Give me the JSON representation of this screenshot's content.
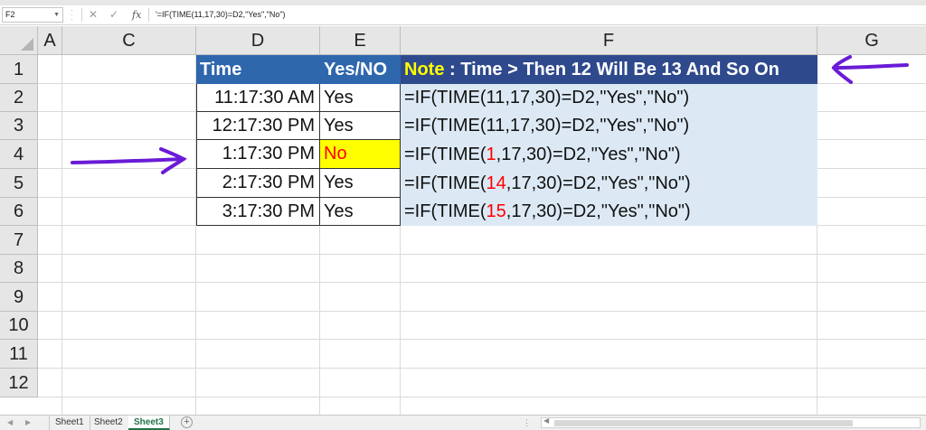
{
  "formula_bar": {
    "name_box": "F2",
    "content": "'=IF(TIME(11,17,30)=D2,\"Yes\",\"No\")"
  },
  "columns": [
    "A",
    "C",
    "D",
    "E",
    "F",
    "G"
  ],
  "rows": [
    "1",
    "2",
    "3",
    "4",
    "5",
    "6",
    "7",
    "8",
    "9",
    "10",
    "11",
    "12"
  ],
  "table": {
    "header_time": "Time",
    "header_yesno": "Yes/NO",
    "note_key": "Note",
    "note_text": " : Time > Then 12 Will Be 13 And So On",
    "rows": [
      {
        "time": "11:17:30 AM",
        "result": "Yes",
        "f_pre": "=IF(TIME(",
        "f_hour": "11",
        "f_post": ",17,30)=D2,\"Yes\",\"No\")"
      },
      {
        "time": "12:17:30 PM",
        "result": "Yes",
        "f_pre": "=IF(TIME(",
        "f_hour": "11",
        "f_post": ",17,30)=D2,\"Yes\",\"No\")"
      },
      {
        "time": "1:17:30 PM",
        "result": "No",
        "f_pre": "=IF(TIME(",
        "f_hour": "1",
        "f_post": ",17,30)=D2,\"Yes\",\"No\")"
      },
      {
        "time": "2:17:30 PM",
        "result": "Yes",
        "f_pre": "=IF(TIME(",
        "f_hour": "14",
        "f_post": ",17,30)=D2,\"Yes\",\"No\")"
      },
      {
        "time": "3:17:30 PM",
        "result": "Yes",
        "f_pre": "=IF(TIME(",
        "f_hour": "15",
        "f_post": ",17,30)=D2,\"Yes\",\"No\")"
      }
    ]
  },
  "sheets": [
    "Sheet1",
    "Sheet2",
    "Sheet3"
  ],
  "active_sheet": "Sheet3",
  "colors": {
    "header_blue": "#2f67ad",
    "note_blue": "#2f4a8c",
    "formula_bg": "#dce9f5",
    "highlight_yellow": "#ffff00",
    "alert_red": "#ff0000",
    "arrow_purple": "#6a1bd6",
    "excel_green": "#217346"
  }
}
